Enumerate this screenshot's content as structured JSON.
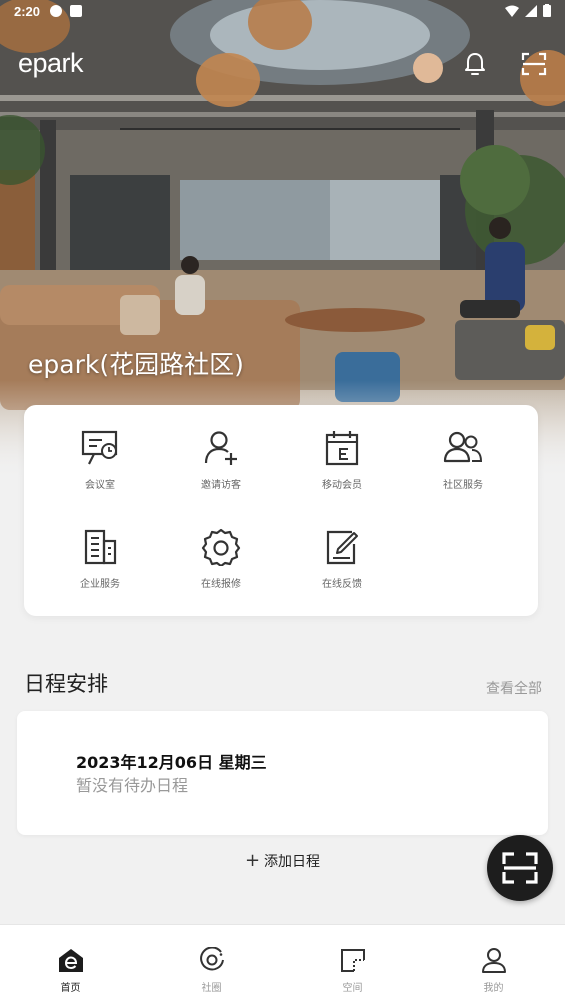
{
  "status": {
    "time": "2:20"
  },
  "brand": {
    "logo": "epark"
  },
  "header": {
    "icons": [
      "bell-icon",
      "scan-icon"
    ]
  },
  "community": {
    "name": "epark(花园路社区)"
  },
  "quick_actions": [
    {
      "label": "会议室",
      "icon": "meeting-room-icon"
    },
    {
      "label": "邀请访客",
      "icon": "invite-visitor-icon"
    },
    {
      "label": "移动会员",
      "icon": "mobile-member-icon"
    },
    {
      "label": "社区服务",
      "icon": "community-service-icon"
    },
    {
      "label": "企业服务",
      "icon": "enterprise-service-icon"
    },
    {
      "label": "在线报修",
      "icon": "repair-gear-icon"
    },
    {
      "label": "在线反馈",
      "icon": "feedback-edit-icon"
    }
  ],
  "schedule": {
    "title": "日程安排",
    "view_all": "查看全部",
    "date": "2023年12月06日 星期三",
    "empty": "暂没有待办日程",
    "add": "添加日程"
  },
  "fab": {
    "icon": "scan-icon"
  },
  "nav": [
    {
      "label": "首页",
      "icon": "home-icon",
      "active": true
    },
    {
      "label": "社圈",
      "icon": "circle-icon",
      "active": false
    },
    {
      "label": "空间",
      "icon": "space-icon",
      "active": false
    },
    {
      "label": "我的",
      "icon": "profile-icon",
      "active": false
    }
  ],
  "colors": {
    "accent": "#1d1d1d",
    "background": "#f1f1f1"
  }
}
